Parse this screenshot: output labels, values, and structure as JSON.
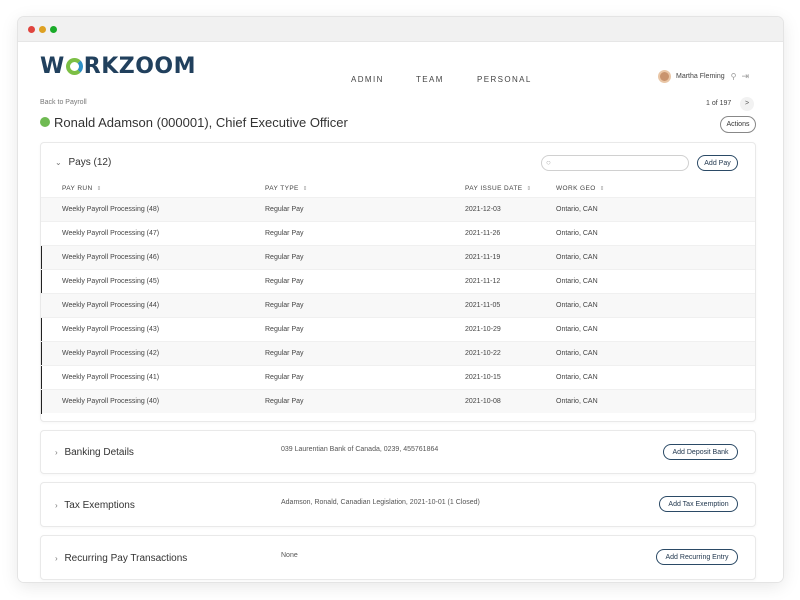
{
  "app": {
    "brand_left": "W",
    "brand_right": "RKZOOM"
  },
  "nav": {
    "admin": "ADMIN",
    "team": "TEAM",
    "personal": "PERSONAL"
  },
  "user": {
    "name": "Martha Fleming"
  },
  "page": {
    "back_link": "Back to Payroll",
    "pager": "1 of 197",
    "pager_next": ">",
    "title": "Ronald Adamson (000001), Chief Executive Officer",
    "actions_label": "Actions",
    "status_color": "#6fba52"
  },
  "pays": {
    "label": "Pays",
    "count": "(12)",
    "search_placeholder": "",
    "add_label": "Add Pay",
    "columns": [
      "PAY RUN",
      "PAY TYPE",
      "PAY ISSUE DATE",
      "WORK GEO"
    ],
    "rows": [
      {
        "run": "Weekly Payroll Processing (48)",
        "type": "Regular Pay",
        "date": "2021-12-03",
        "geo": "Ontario, CAN"
      },
      {
        "run": "Weekly Payroll Processing (47)",
        "type": "Regular Pay",
        "date": "2021-11-26",
        "geo": "Ontario, CAN"
      },
      {
        "run": "Weekly Payroll Processing (46)",
        "type": "Regular Pay",
        "date": "2021-11-19",
        "geo": "Ontario, CAN"
      },
      {
        "run": "Weekly Payroll Processing (45)",
        "type": "Regular Pay",
        "date": "2021-11-12",
        "geo": "Ontario, CAN"
      },
      {
        "run": "Weekly Payroll Processing (44)",
        "type": "Regular Pay",
        "date": "2021-11-05",
        "geo": "Ontario, CAN"
      },
      {
        "run": "Weekly Payroll Processing (43)",
        "type": "Regular Pay",
        "date": "2021-10-29",
        "geo": "Ontario, CAN"
      },
      {
        "run": "Weekly Payroll Processing (42)",
        "type": "Regular Pay",
        "date": "2021-10-22",
        "geo": "Ontario, CAN"
      },
      {
        "run": "Weekly Payroll Processing (41)",
        "type": "Regular Pay",
        "date": "2021-10-15",
        "geo": "Ontario, CAN"
      },
      {
        "run": "Weekly Payroll Processing (40)",
        "type": "Regular Pay",
        "date": "2021-10-08",
        "geo": "Ontario, CAN"
      }
    ]
  },
  "banking": {
    "title": "Banking Details",
    "value": "039 Laurentian Bank of Canada, 0239, 455761864",
    "button": "Add Deposit Bank"
  },
  "tax": {
    "title": "Tax Exemptions",
    "value": "Adamson, Ronald, Canadian Legislation, 2021-10-01 (1 Closed)",
    "button": "Add Tax Exemption"
  },
  "recurring": {
    "title": "Recurring Pay Transactions",
    "value": "None",
    "button": "Add Recurring Entry"
  }
}
